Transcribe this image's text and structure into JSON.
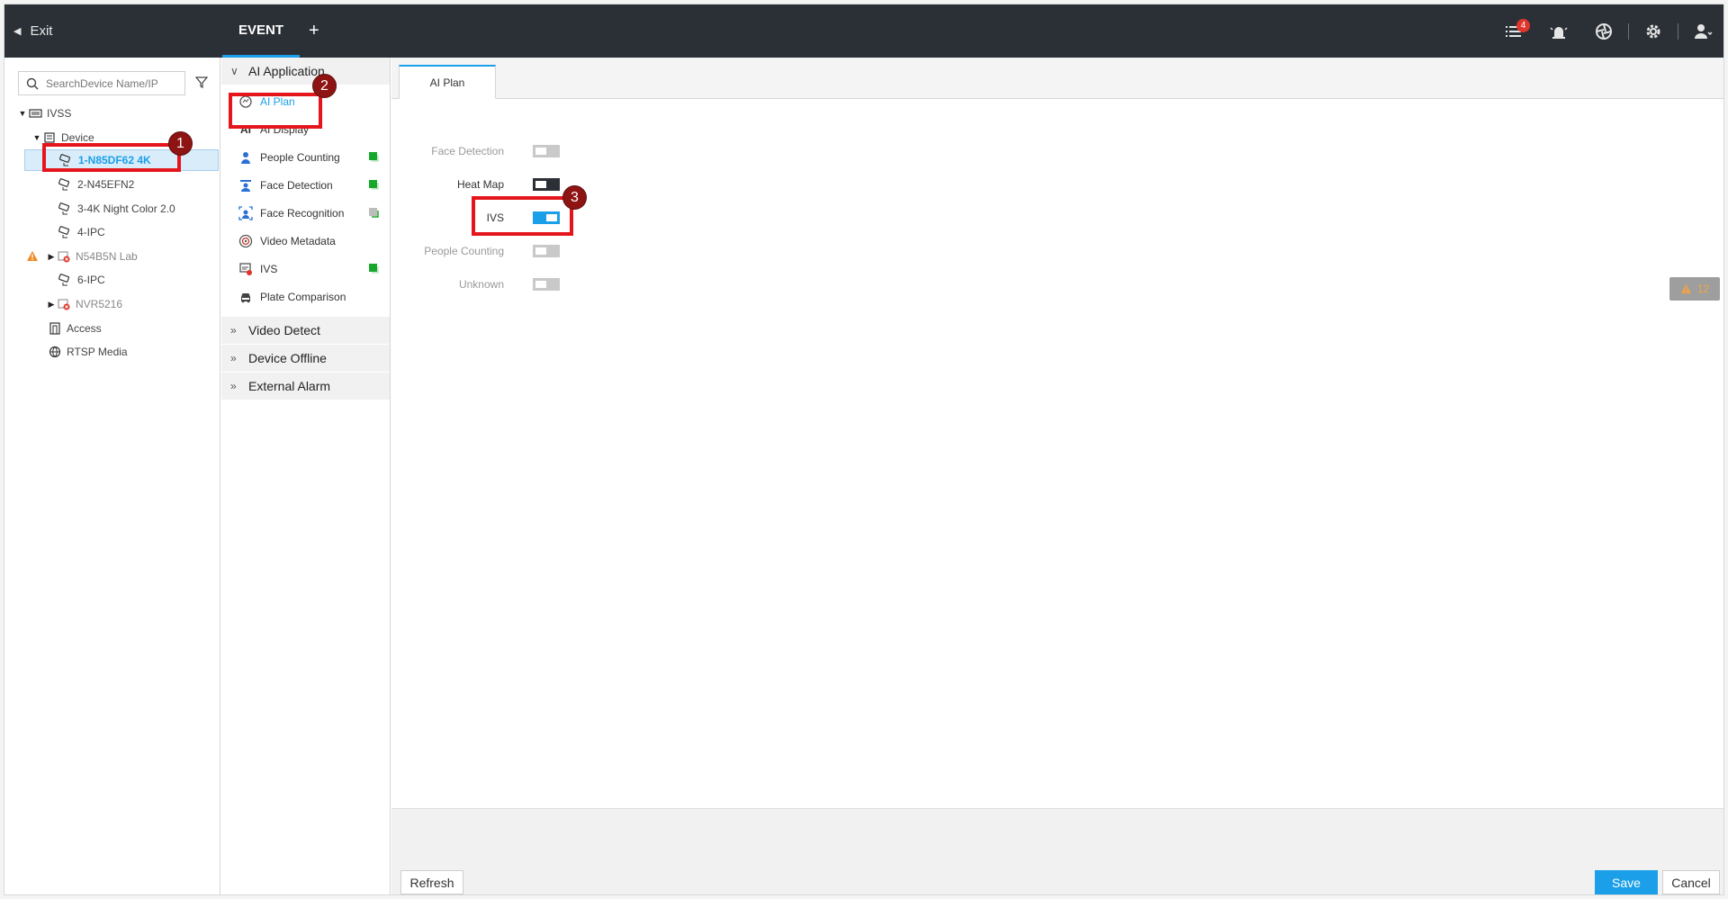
{
  "topbar": {
    "exit_label": "Exit",
    "active_tab": "EVENT",
    "add_tab": "+",
    "notification_count": "4",
    "icons": [
      "task-list-icon",
      "alarm-icon",
      "aperture-icon",
      "gear-icon",
      "user-icon"
    ]
  },
  "tree": {
    "search_placeholder": "SearchDevice Name/IP",
    "root": "IVSS",
    "device_group": "Device",
    "devices": [
      {
        "label": "1-N85DF62 4K",
        "status": "selected"
      },
      {
        "label": "2-N45EFN2",
        "status": "online"
      },
      {
        "label": "3-4K Night Color 2.0",
        "status": "online"
      },
      {
        "label": "4-IPC",
        "status": "online"
      },
      {
        "label": "N54B5N Lab",
        "status": "offline"
      },
      {
        "label": "6-IPC",
        "status": "online"
      },
      {
        "label": "NVR5216",
        "status": "offline"
      }
    ],
    "access": "Access",
    "rtsp": "RTSP Media"
  },
  "menu": {
    "section_ai": "AI Application",
    "items": [
      {
        "label": "AI Plan",
        "icon": "ai-plan-icon",
        "active": true
      },
      {
        "label": "AI Display",
        "icon": "ai-display-icon"
      },
      {
        "label": "People Counting",
        "icon": "people-counting-icon",
        "indicator": "green"
      },
      {
        "label": "Face Detection",
        "icon": "face-detection-icon",
        "indicator": "green"
      },
      {
        "label": "Face Recognition",
        "icon": "face-recognition-icon",
        "indicator": "gray"
      },
      {
        "label": "Video Metadata",
        "icon": "video-metadata-icon"
      },
      {
        "label": "IVS",
        "icon": "ivs-icon",
        "indicator": "green"
      },
      {
        "label": "Plate Comparison",
        "icon": "plate-comparison-icon"
      }
    ],
    "section_video_detect": "Video Detect",
    "section_device_offline": "Device Offline",
    "section_external_alarm": "External Alarm"
  },
  "content": {
    "tab": "AI Plan",
    "plans": [
      {
        "label": "Face Detection",
        "state": "disabled"
      },
      {
        "label": "Heat Map",
        "state": "off"
      },
      {
        "label": "IVS",
        "state": "on"
      },
      {
        "label": "People Counting",
        "state": "disabled"
      },
      {
        "label": "Unknown",
        "state": "disabled"
      }
    ],
    "alert_count": "12"
  },
  "footer": {
    "refresh": "Refresh",
    "save": "Save",
    "cancel": "Cancel"
  },
  "callouts": [
    "1",
    "2",
    "3"
  ],
  "colors": {
    "accent": "#1a9fe8",
    "topbar": "#2b3037",
    "callout_border": "#e4161c",
    "callout_badge": "#8e1413",
    "indicator_green": "#17a82b"
  }
}
